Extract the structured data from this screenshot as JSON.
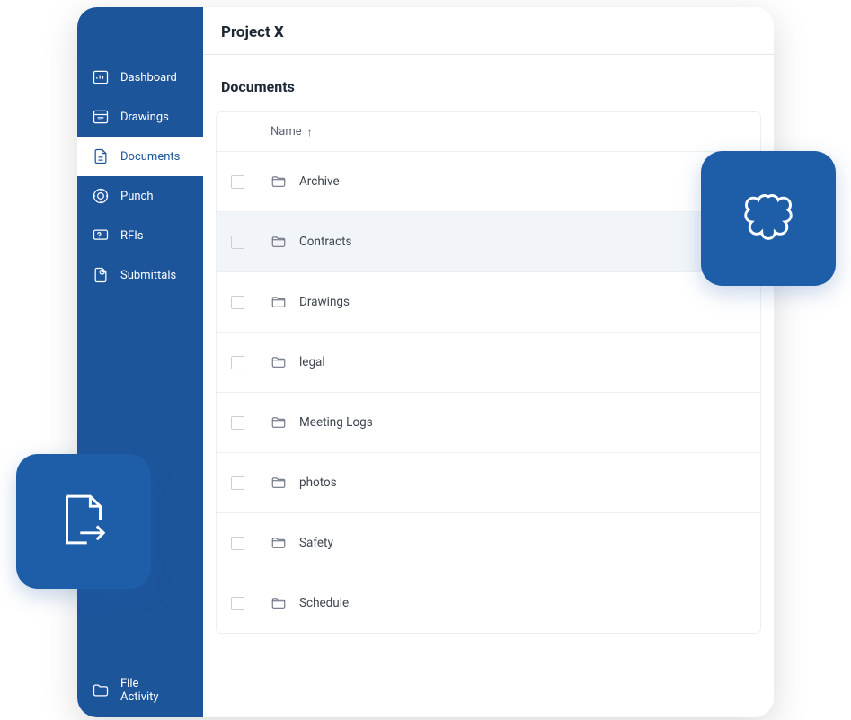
{
  "header": {
    "project_title": "Project X"
  },
  "page": {
    "title": "Documents"
  },
  "sidebar": {
    "items": [
      {
        "label": "Dashboard",
        "active": false
      },
      {
        "label": "Drawings",
        "active": false
      },
      {
        "label": "Documents",
        "active": true
      },
      {
        "label": "Punch",
        "active": false
      },
      {
        "label": "RFIs",
        "active": false
      },
      {
        "label": "Submittals",
        "active": false
      }
    ],
    "bottom": {
      "label": "File\nActivity"
    }
  },
  "table": {
    "column_header": "Name",
    "sort_indicator": "↑",
    "rows": [
      {
        "name": "Archive",
        "selected": false
      },
      {
        "name": "Contracts",
        "selected": true
      },
      {
        "name": "Drawings",
        "selected": false
      },
      {
        "name": "legal",
        "selected": false
      },
      {
        "name": "Meeting Logs",
        "selected": false
      },
      {
        "name": "photos",
        "selected": false
      },
      {
        "name": "Safety",
        "selected": false
      },
      {
        "name": "Schedule",
        "selected": false
      }
    ]
  },
  "decorations": {
    "left_icon": "file-export-icon",
    "right_icon": "flower-icon"
  }
}
